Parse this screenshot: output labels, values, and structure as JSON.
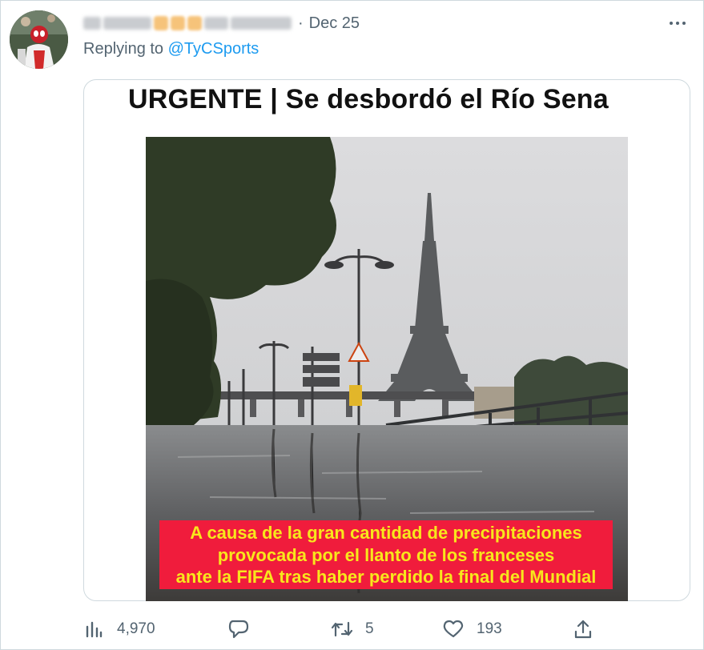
{
  "tweet": {
    "date": "Dec 25",
    "separator": "·",
    "replying_prefix": "Replying to ",
    "replying_handle": "@TyCSports"
  },
  "media": {
    "headline": "URGENTE | Se desbordó el Río Sena",
    "caption_lines": [
      "A causa de la gran cantidad de precipitaciones",
      "provocada por el llanto de los franceses",
      "ante la FIFA tras haber perdido la final del Mundial"
    ],
    "caption_bg": "#f01c3c",
    "caption_color": "#f8e71c"
  },
  "actions": {
    "views": {
      "icon": "analytics-icon",
      "count": "4,970"
    },
    "reply": {
      "icon": "reply-icon",
      "count": ""
    },
    "retweet": {
      "icon": "retweet-icon",
      "count": "5"
    },
    "like": {
      "icon": "heart-icon",
      "count": "193"
    },
    "share": {
      "icon": "share-icon",
      "count": ""
    }
  },
  "colors": {
    "link": "#1d9bf0",
    "muted": "#536471",
    "border": "#cfd9de"
  }
}
